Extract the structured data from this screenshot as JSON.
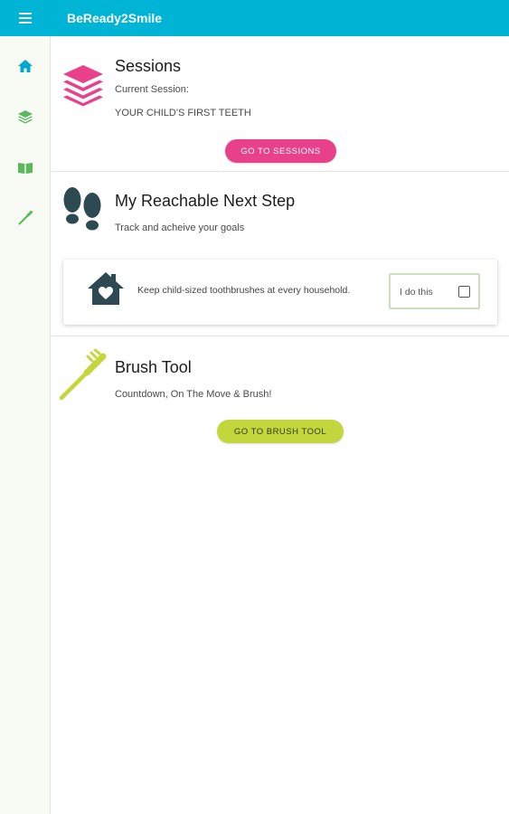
{
  "appbar": {
    "title": "BeReady2Smile",
    "menu_icon": "menu-icon",
    "color": "#00b4d5"
  },
  "rail": {
    "items": [
      {
        "icon": "home-icon",
        "color": "#00a9cc"
      },
      {
        "icon": "layers-icon",
        "color": "#5cb85c"
      },
      {
        "icon": "book-icon",
        "color": "#5cb85c"
      },
      {
        "icon": "toothbrush-icon",
        "color": "#5cb85c"
      }
    ]
  },
  "sessions": {
    "title": "Sessions",
    "label": "Current Session:",
    "current": "YOUR CHILD'S FIRST TEETH",
    "button": "GO TO SESSIONS",
    "icon": "stacked-layers-icon",
    "color": "#e8408b"
  },
  "next_step": {
    "title": "My Reachable Next Step",
    "subtitle": "Track and acheive your goals",
    "icon": "footprints-icon",
    "card": {
      "icon": "house-heart-icon",
      "text": "Keep child-sized toothbrushes at every household.",
      "checkbox_label": "I do this",
      "checked": false
    }
  },
  "brush_tool": {
    "title": "Brush Tool",
    "subtitle": "Countdown, On The Move & Brush!",
    "button": "GO TO BRUSH TOOL",
    "icon": "toothbrush-icon",
    "color": "#c3d73c"
  }
}
